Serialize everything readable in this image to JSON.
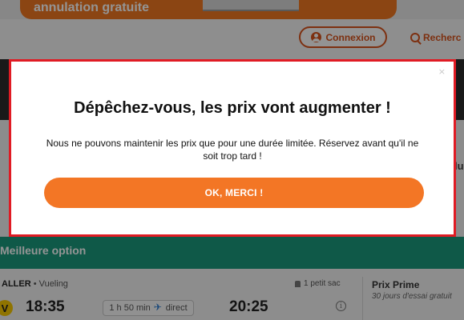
{
  "promo": {
    "text": "annulation gratuite"
  },
  "header": {
    "login_label": "Connexion",
    "search_label": "Recherc"
  },
  "results": {
    "section_label": "Meilleure option",
    "right_partial_text": "lu",
    "flight": {
      "direction": "ALLER",
      "airline": "• Vueling",
      "airline_logo_letter": "V",
      "departure": "18:35",
      "duration": "1 h 50 min",
      "stops": "direct",
      "arrival": "20:25",
      "baggage": "1 petit sac",
      "info_glyph": "i"
    },
    "prime": {
      "title": "Prix Prime",
      "subtitle": "30 jours d'essai gratuit"
    }
  },
  "modal": {
    "close_glyph": "×",
    "title": "Dépêchez-vous, les prix vont augmenter !",
    "body": "Nous ne pouvons maintenir les prix que pour une durée limitée. Réservez avant qu'il ne soit trop tard !",
    "ok_label": "OK, MERCI !"
  },
  "colors": {
    "accent_orange": "#f37625",
    "brand_orange": "#f07822",
    "login_orange": "#d8531d",
    "green": "#1a9a7d",
    "modal_border": "#e01b24",
    "plane_blue": "#2a7bd1"
  }
}
